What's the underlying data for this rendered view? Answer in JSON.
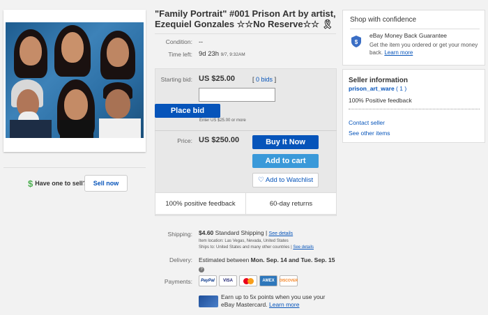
{
  "left": {
    "have_one": "Have one to sell?",
    "sell_now": "Sell now"
  },
  "title": "\"Family Portrait\" #001 Prison Art by artist, Ezequiel Gonzales ☆☆No Reserve☆☆ 🎗",
  "condition": {
    "label": "Condition:",
    "value": "--"
  },
  "time_left": {
    "label": "Time left:",
    "value": "9d 23h",
    "detail": "9/7, 9:32AM"
  },
  "bid": {
    "label": "Starting bid:",
    "price": "US $25.00",
    "bids_open": "[",
    "bids": "0 bids",
    "bids_close": "]",
    "place_bid": "Place bid",
    "enter_hint": "Enter US $25.00 or more"
  },
  "buy": {
    "label": "Price:",
    "price": "US $250.00",
    "buy_now": "Buy It Now",
    "add_cart": "Add to cart",
    "watchlist": "Add to Watchlist"
  },
  "feedback": {
    "positive": "100% positive feedback",
    "returns": "60-day returns"
  },
  "shipping": {
    "label": "Shipping:",
    "cost": "$4.60",
    "method": "Standard Shipping |",
    "see_details": "See details",
    "location": "Item location:  Las Vegas, Nevada, United States",
    "ships_to": "Ships to:  United States and many other countries |",
    "see_details2": "See details"
  },
  "delivery": {
    "label": "Delivery:",
    "prefix": "Estimated between",
    "range": "Mon. Sep. 14 and Tue. Sep. 15"
  },
  "payments": {
    "label": "Payments:",
    "logos": [
      "PayPal",
      "VISA",
      "MC",
      "AMEX",
      "DISCOVER"
    ]
  },
  "mastercard": {
    "line1": "Earn up to 5x points when you use your",
    "line2": "eBay Mastercard.",
    "learn": "Learn more"
  },
  "confidence": {
    "title": "Shop with confidence",
    "guarantee": "eBay Money Back Guarantee",
    "desc": "Get the item you ordered or get your money back.",
    "learn": "Learn more"
  },
  "seller": {
    "title": "Seller information",
    "name": "prison_art_ware",
    "score": "( 1 )",
    "feedback": "100% Positive feedback",
    "contact": "Contact seller",
    "other_items": "See other items"
  },
  "colors": {
    "ebay_blue": "#0654ba",
    "cart_blue": "#3a99d9",
    "link": "#0654ba"
  }
}
